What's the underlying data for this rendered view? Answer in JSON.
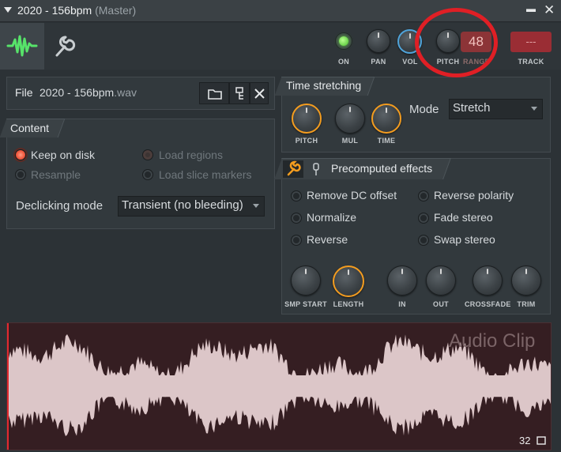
{
  "titlebar": {
    "title": "2020 - 156bpm",
    "subtitle": "(Master)"
  },
  "header": {
    "on_label": "ON",
    "pan_label": "PAN",
    "vol_label": "VOL",
    "pitch_label": "PITCH",
    "range_label": "RANGE",
    "range_value": "48",
    "track_label": "TRACK",
    "track_value": "---"
  },
  "file": {
    "label": "File",
    "filename": "2020 - 156bpm",
    "extension": ".wav"
  },
  "content": {
    "title": "Content",
    "options": [
      {
        "label": "Keep on disk",
        "checked": true
      },
      {
        "label": "Resample",
        "checked": false
      },
      {
        "label": "Load regions",
        "checked": false
      },
      {
        "label": "Load slice markers",
        "checked": false
      }
    ],
    "declicking_label": "Declicking mode",
    "declicking_value": "Transient (no bleeding)"
  },
  "time_stretching": {
    "title": "Time stretching",
    "knobs": [
      "PITCH",
      "MUL",
      "TIME"
    ],
    "mode_label": "Mode",
    "mode_value": "Stretch"
  },
  "precomputed": {
    "title": "Precomputed effects",
    "effects_left": [
      "Remove DC offset",
      "Normalize",
      "Reverse"
    ],
    "effects_right": [
      "Reverse polarity",
      "Fade stereo",
      "Swap stereo"
    ],
    "knobs": [
      "SMP START",
      "LENGTH",
      "IN",
      "OUT",
      "CROSSFADE",
      "TRIM"
    ]
  },
  "waveform": {
    "title": "Audio Clip",
    "zoom": "32"
  },
  "colors": {
    "accent_orange": "#f39c1f",
    "accent_blue": "#4fa3d9",
    "wave_fill": "#dcc6c8",
    "annotation_red": "#e01f25"
  }
}
